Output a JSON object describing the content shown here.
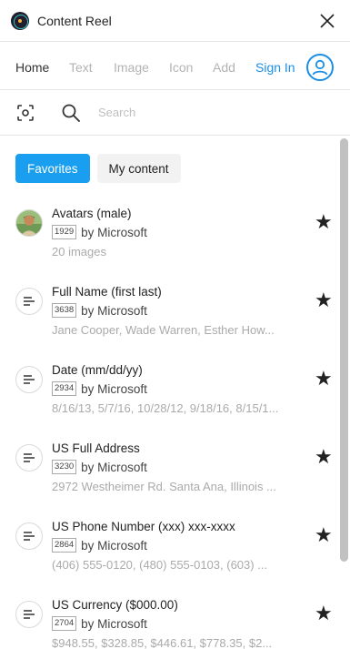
{
  "app": {
    "title": "Content Reel"
  },
  "nav": {
    "tabs": [
      {
        "label": "Home"
      },
      {
        "label": "Text"
      },
      {
        "label": "Image"
      },
      {
        "label": "Icon"
      },
      {
        "label": "Add"
      }
    ],
    "sign_in": "Sign In"
  },
  "search": {
    "placeholder": "Search",
    "value": ""
  },
  "filters": {
    "favorites": "Favorites",
    "my_content": "My content"
  },
  "items": [
    {
      "title": "Avatars (male)",
      "count": "1929",
      "author": "by Microsoft",
      "description": "20 images",
      "icon": "avatar-photo"
    },
    {
      "title": "Full Name (first last)",
      "count": "3638",
      "author": "by Microsoft",
      "description": "Jane Cooper, Wade Warren, Esther How...",
      "icon": "text-lines-icon"
    },
    {
      "title": "Date (mm/dd/yy)",
      "count": "2934",
      "author": "by Microsoft",
      "description": "8/16/13, 5/7/16, 10/28/12, 9/18/16, 8/15/1...",
      "icon": "text-lines-icon"
    },
    {
      "title": "US Full Address",
      "count": "3230",
      "author": "by Microsoft",
      "description": "2972 Westheimer Rd. Santa Ana, Illinois ...",
      "icon": "text-lines-icon"
    },
    {
      "title": "US Phone Number (xxx) xxx-xxxx",
      "count": "2864",
      "author": "by Microsoft",
      "description": "(406) 555-0120, (480) 555-0103, (603) ...",
      "icon": "text-lines-icon"
    },
    {
      "title": "US Currency ($000.00)",
      "count": "2704",
      "author": "by Microsoft",
      "description": "$948.55, $328.85, $446.61, $778.35, $2...",
      "icon": "text-lines-icon"
    }
  ],
  "colors": {
    "accent": "#1a9ff0",
    "link": "#1a8fe6"
  }
}
